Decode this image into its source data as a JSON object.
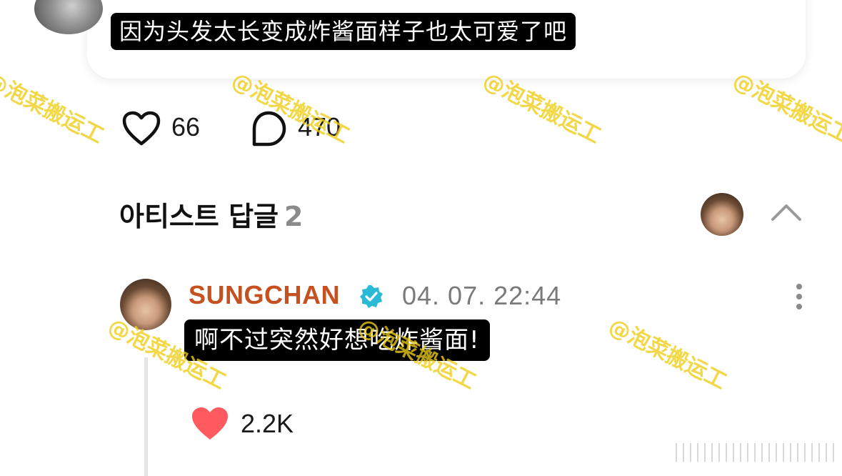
{
  "post": {
    "text": "因为头发太长变成炸酱面样子也太可爱了吧",
    "like_count": "66",
    "comment_count": "470"
  },
  "artist_replies": {
    "title": "아티스트 답글",
    "count": "2"
  },
  "reply": {
    "username": "SUNGCHAN",
    "timestamp": "04. 07. 22:44",
    "text": "啊不过突然好想吃炸酱面!",
    "like_count": "2.2K"
  },
  "watermark": {
    "text": "@泡菜搬运工"
  },
  "colors": {
    "username": "#c4511f",
    "verified_badge": "#2bbad6",
    "liked_heart": "#ff5a5f",
    "watermark": "#eecd14"
  }
}
